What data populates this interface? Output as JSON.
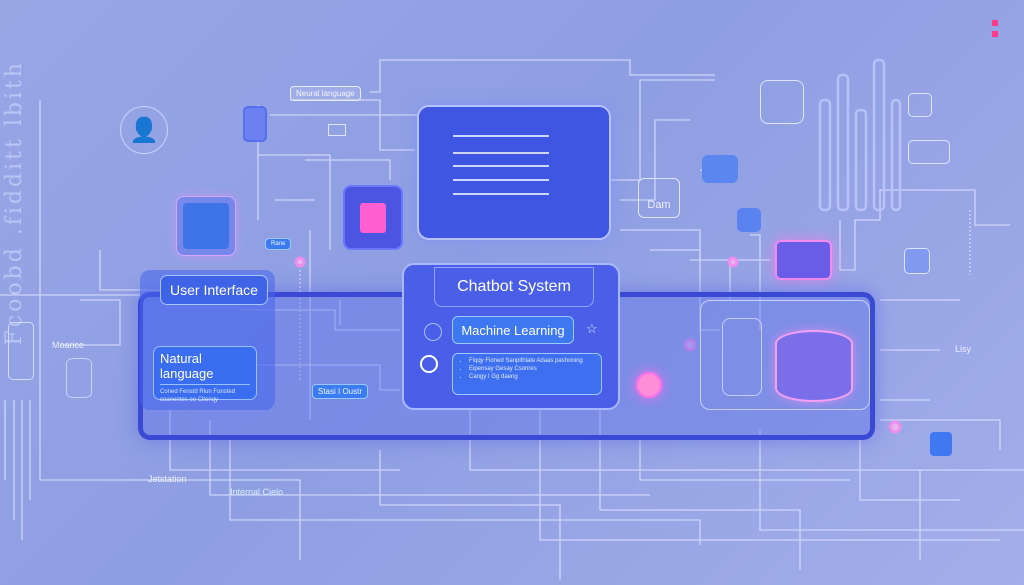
{
  "colors": {
    "background": "#94a3e4",
    "panel": "#3a4ad4",
    "accent_pink": "#f070e0",
    "accent_blue": "#3d78f0"
  },
  "side_text": "Fcoobd .fidditt lbith",
  "labels": {
    "neural_language": "Neural language",
    "user_interface": "User Interface",
    "natural_language": "Natural language",
    "natural_language_desc": "Coned Fenstd Rlun Fonsted coanentes oo Citenqy",
    "chatbot_system": "Chatbot System",
    "machine_learning": "Machine Learning",
    "info_items": [
      "Fiqqy Fioned Sanpithlale Adaas pashoning",
      "Eipensay Gesay Csonres",
      "Cangy I Gg daeng"
    ],
    "start_button": "Stasi I Oustr",
    "dam": "Dam",
    "moarice": "Moarice",
    "jetstation": "Jetstation",
    "internal_calls": "Internal Cielo",
    "lisy": "Lisy",
    "plans_tag": "Rane"
  },
  "icons": [
    "user-avatar-icon",
    "database-icon",
    "mail-icon",
    "chart-icon",
    "document-icon",
    "search-icon",
    "star-icon",
    "gear-icon",
    "music-icon",
    "sparkle-icon",
    "grid-icon",
    "bar-chart-icon",
    "heart-icon",
    "chat-icon",
    "clock-icon",
    "menu-icon",
    "play-icon",
    "shield-icon"
  ]
}
